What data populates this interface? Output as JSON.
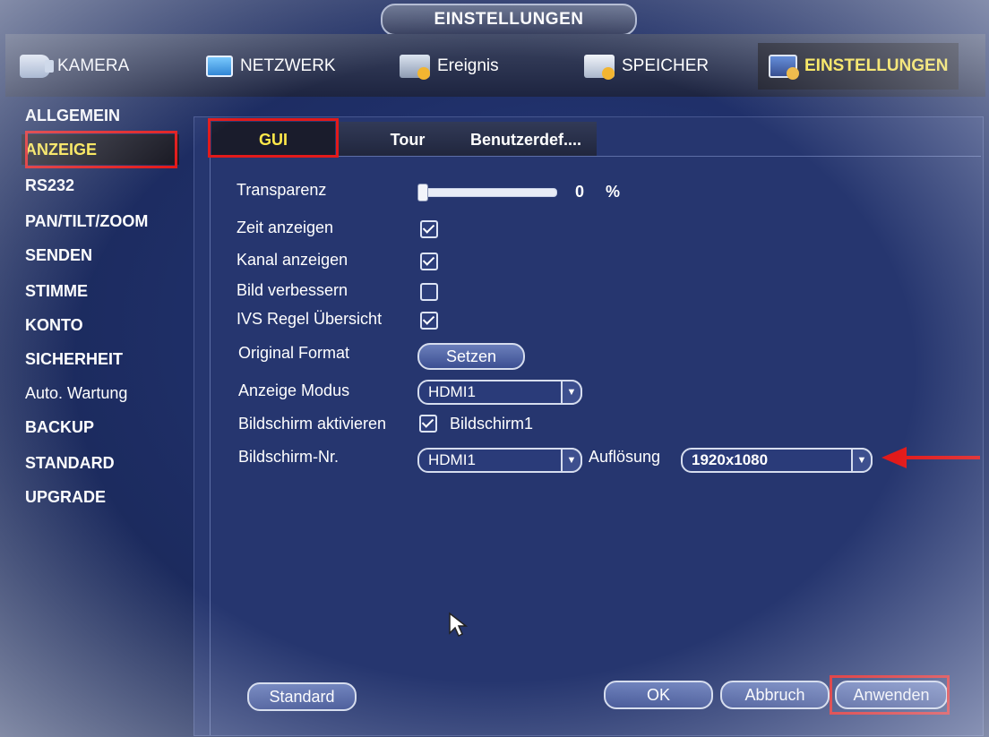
{
  "window": {
    "title": "EINSTELLUNGEN"
  },
  "topnav": [
    {
      "label": "KAMERA",
      "icon": "camera-icon"
    },
    {
      "label": "NETZWERK",
      "icon": "network-icon"
    },
    {
      "label": "Ereignis",
      "icon": "event-icon"
    },
    {
      "label": "SPEICHER",
      "icon": "storage-icon"
    },
    {
      "label": "EINSTELLUNGEN",
      "icon": "settings-icon",
      "active": true
    }
  ],
  "sidebar": {
    "items": [
      {
        "label": "ALLGEMEIN"
      },
      {
        "label": "ANZEIGE",
        "active": true
      },
      {
        "label": "RS232"
      },
      {
        "label": "PAN/TILT/ZOOM"
      },
      {
        "label": "SENDEN"
      },
      {
        "label": "STIMME"
      },
      {
        "label": "KONTO"
      },
      {
        "label": "SICHERHEIT"
      },
      {
        "label": "Auto. Wartung"
      },
      {
        "label": "BACKUP"
      },
      {
        "label": "STANDARD"
      },
      {
        "label": "UPGRADE"
      }
    ]
  },
  "tabs": [
    {
      "label": "GUI",
      "active": true
    },
    {
      "label": "Tour"
    },
    {
      "label": "Benutzerdef...."
    }
  ],
  "form": {
    "transparency": {
      "label": "Transparenz",
      "value": "0",
      "unit": "%",
      "level": 0
    },
    "show_time": {
      "label": "Zeit anzeigen",
      "checked": true
    },
    "show_channel": {
      "label": "Kanal anzeigen",
      "checked": true
    },
    "enhance_image": {
      "label": "Bild verbessern",
      "checked": false
    },
    "ivs_rules": {
      "label": "IVS Regel Übersicht",
      "checked": true
    },
    "original_format": {
      "label": "Original Format",
      "button": "Setzen"
    },
    "display_mode": {
      "label": "Anzeige Modus",
      "value": "HDMI1"
    },
    "screen_enable": {
      "label": "Bildschirm aktivieren",
      "checked": true,
      "option_label": "Bildschirm1"
    },
    "screen_no": {
      "label": "Bildschirm-Nr.",
      "value": "HDMI1"
    },
    "resolution": {
      "label": "Auflösung",
      "value": "1920x1080"
    }
  },
  "footer": {
    "standard": "Standard",
    "ok": "OK",
    "cancel": "Abbruch",
    "apply": "Anwenden"
  },
  "colors": {
    "accent_yellow": "#ffe94a",
    "annotation_red": "#e21a1a",
    "panel_blue": "#26366f"
  }
}
